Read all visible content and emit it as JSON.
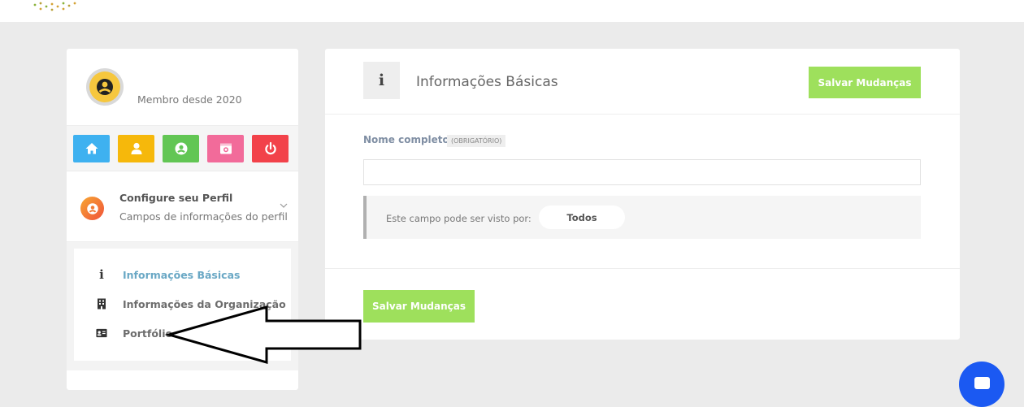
{
  "profile": {
    "member_since": "Membro desde 2020"
  },
  "quick_actions": [
    {
      "icon": "home-icon",
      "color": "#3eb1f0"
    },
    {
      "icon": "user-icon",
      "color": "#f6b80b"
    },
    {
      "icon": "user-circle-icon",
      "color": "#62c654"
    },
    {
      "icon": "camera-icon",
      "color": "#f26b9a"
    },
    {
      "icon": "power-icon",
      "color": "#f2424a"
    }
  ],
  "configure": {
    "title": "Configure seu Perfil",
    "subtitle": "Campos de informações do perfil"
  },
  "menu": {
    "items": [
      {
        "label": "Informações Básicas",
        "icon": "info-icon",
        "active": true
      },
      {
        "label": "Informações da Organização",
        "icon": "building-icon",
        "active": false
      },
      {
        "label": "Portfólio",
        "icon": "id-card-icon",
        "active": false
      }
    ]
  },
  "section": {
    "title": "Informações Básicas",
    "header_icon": "i",
    "save_label": "Salvar Mudanças"
  },
  "form": {
    "full_name_label": "Nome completo",
    "required_badge": "(OBRIGATÓRIO)",
    "full_name_value": "",
    "visibility_label": "Este campo pode ser visto por:",
    "visibility_value": "Todos"
  },
  "footer": {
    "save_label": "Salvar Mudanças"
  },
  "colors": {
    "accent_green": "#9ee05c",
    "active_link": "#6aa8c5",
    "chat_blue": "#1b59f2"
  }
}
